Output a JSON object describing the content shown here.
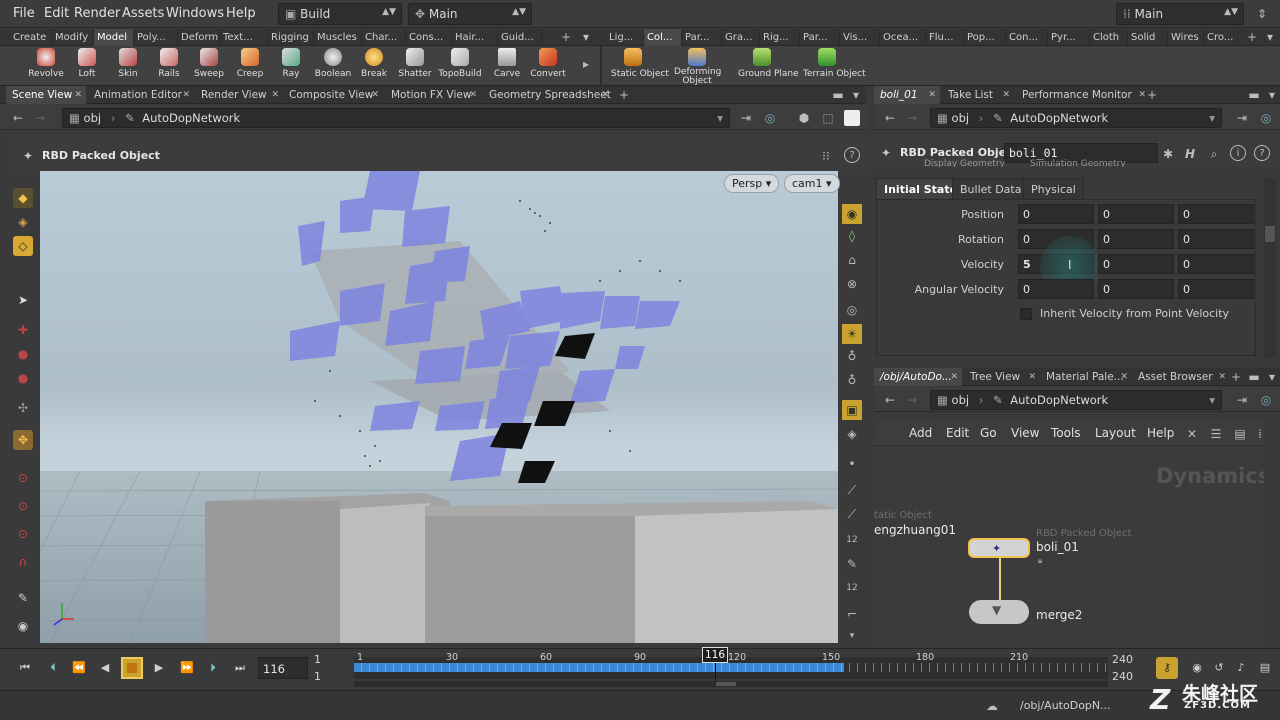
{
  "menu": {
    "items": [
      "File",
      "Edit",
      "Render",
      "Assets",
      "Windows",
      "Help"
    ],
    "desktop": "Build",
    "context": "Main",
    "main_right": "Main"
  },
  "shelf_tabs_left": [
    "Create",
    "Modify",
    "Model",
    "Poly...",
    "Deform",
    "Text...",
    "Rigging",
    "Muscles",
    "Char...",
    "Cons...",
    "Hair...",
    "Guid..."
  ],
  "shelf_tabs_right": [
    "Lig...",
    "Col...",
    "Par...",
    "Gra...",
    "Rig...",
    "Par...",
    "Vis...",
    "Ocea...",
    "Flu...",
    "Pop...",
    "Con...",
    "Pyr...",
    "Cloth",
    "Solid",
    "Wires",
    "Cro..."
  ],
  "shelf_tools_left": [
    "Revolve",
    "Loft",
    "Skin",
    "Rails",
    "Sweep",
    "Creep",
    "Ray",
    "Boolean",
    "Break",
    "Shatter",
    "TopoBuild",
    "Carve",
    "Convert"
  ],
  "shelf_tools_right": [
    "Static Object",
    "Deforming Object",
    "Ground Plane",
    "Terrain Object"
  ],
  "left_pane_tabs": [
    "Scene View",
    "Animation Editor",
    "Render View",
    "Composite View",
    "Motion FX View",
    "Geometry Spreadsheet"
  ],
  "right_top_tabs": [
    "boli_01",
    "Take List",
    "Performance Monitor"
  ],
  "right_bottom_tabs": [
    "/obj/AutoDo...",
    "Tree View",
    "Material Pale...",
    "Asset Browser"
  ],
  "path": {
    "root": "obj",
    "network": "AutoDopNetwork"
  },
  "viewport": {
    "title": "RBD Packed Object",
    "camera_mode": "Persp",
    "camera": "cam1"
  },
  "params": {
    "node_type": "RBD Packed Object",
    "node_name": "boli_01",
    "hidden_row": "Display Geometry",
    "hidden_value": "Simulation Geometry",
    "tabs": [
      "Initial State",
      "Bullet Data",
      "Physical"
    ],
    "rows": [
      {
        "label": "Position",
        "v": [
          "0",
          "0",
          "0"
        ]
      },
      {
        "label": "Rotation",
        "v": [
          "0",
          "0",
          "0"
        ]
      },
      {
        "label": "Velocity",
        "v": [
          "5",
          "0",
          "0"
        ]
      },
      {
        "label": "Angular Velocity",
        "v": [
          "0",
          "0",
          "0"
        ]
      }
    ],
    "checkbox_label": "Inherit Velocity from Point Velocity"
  },
  "network_menu": [
    "Add",
    "Edit",
    "Go",
    "View",
    "Tools",
    "Layout",
    "Help"
  ],
  "network": {
    "watermark": "Dynamics",
    "node1": {
      "type": "tatic Object",
      "name": "engzhuang01"
    },
    "node2": {
      "type": "RBD Packed Object",
      "name": "boli_01"
    },
    "node3": {
      "name": "merge2"
    }
  },
  "timeline": {
    "current_frame": "116",
    "start": "1",
    "start2": "1",
    "end": "240",
    "end2": "240",
    "ticks": [
      "1",
      "30",
      "60",
      "90",
      "120",
      "150",
      "180",
      "210"
    ],
    "marker": "116"
  },
  "status": {
    "path": "/obj/AutoDopN...",
    "watermark": "朱峰社区",
    "watermark_sub": "ZF3D.COM"
  }
}
